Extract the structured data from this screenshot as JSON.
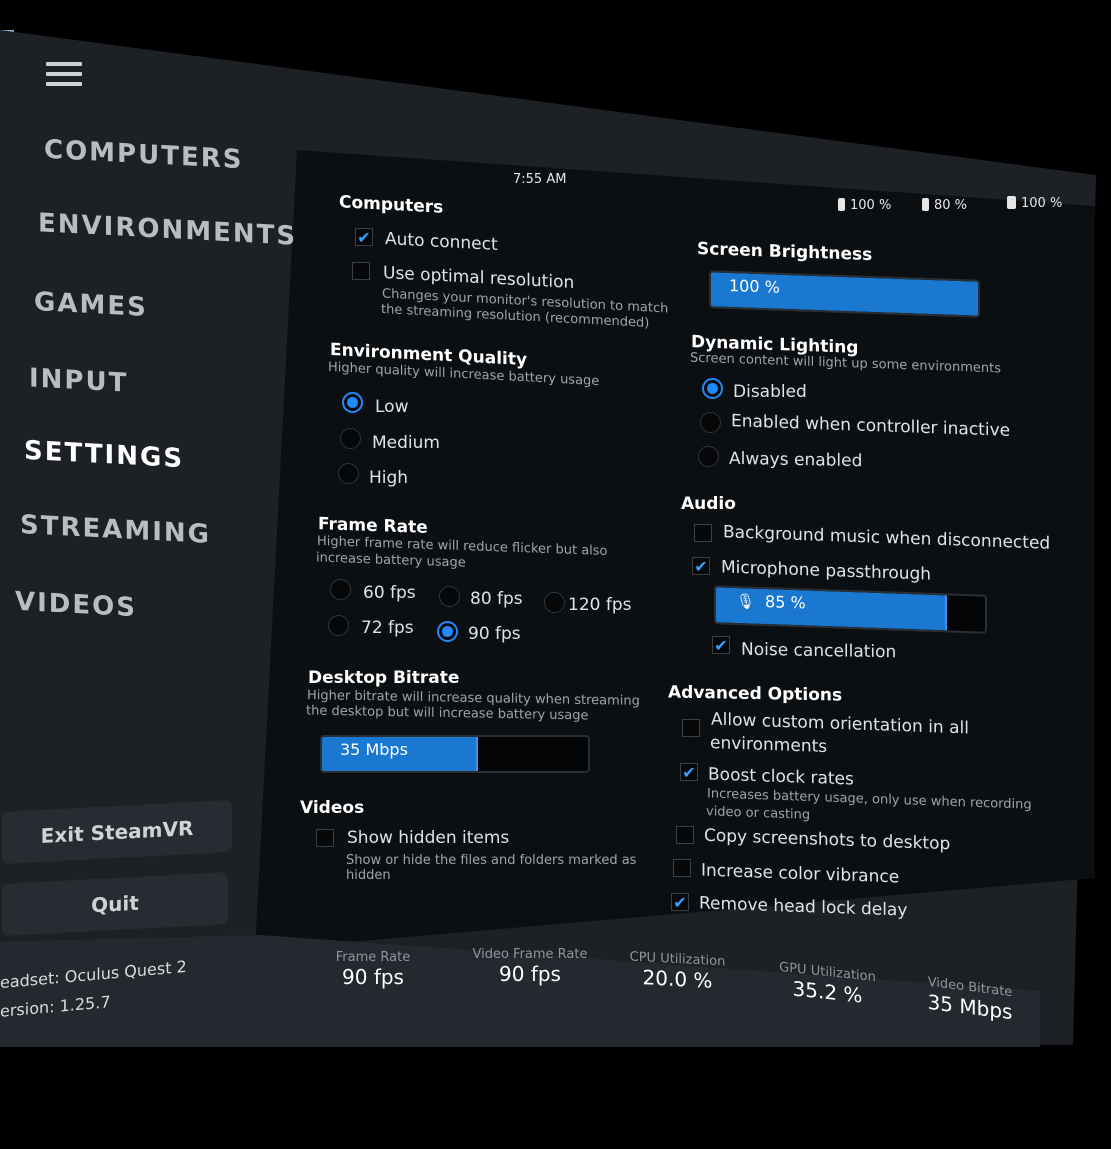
{
  "clock": "7:55 AM",
  "battery": [
    {
      "value": "100 %"
    },
    {
      "value": "80 %"
    },
    {
      "value": "100 %"
    }
  ],
  "nav": [
    "COMPUTERS",
    "ENVIRONMENTS",
    "GAMES",
    "INPUT",
    "SETTINGS",
    "STREAMING",
    "VIDEOS"
  ],
  "buttons": {
    "exit": "Exit SteamVR",
    "quit": "Quit"
  },
  "device": {
    "headset": "eadset:  Oculus Quest 2",
    "version": "ersion:  1.25.7"
  },
  "computers": {
    "title": "Computers",
    "auto_connect": "Auto connect",
    "optimal_res": "Use optimal resolution",
    "optimal_res_desc1": "Changes your monitor's resolution to match",
    "optimal_res_desc2": "the streaming resolution (recommended)"
  },
  "env_quality": {
    "title": "Environment Quality",
    "desc": "Higher quality will increase battery usage",
    "options": [
      "Low",
      "Medium",
      "High"
    ]
  },
  "frame_rate": {
    "title": "Frame Rate",
    "desc1": "Higher frame rate will reduce flicker but also",
    "desc2": "increase battery usage",
    "options": [
      "60 fps",
      "80 fps",
      "120 fps",
      "72 fps",
      "90 fps"
    ]
  },
  "desktop_bitrate": {
    "title": "Desktop Bitrate",
    "desc1": "Higher bitrate will increase quality when streaming",
    "desc2": "the desktop but will increase battery usage",
    "value": "35 Mbps",
    "fraction": 0.58
  },
  "videos": {
    "title": "Videos",
    "show_hidden": "Show hidden items",
    "desc1": "Show or hide the files and folders marked as",
    "desc2": "hidden"
  },
  "brightness": {
    "title": "Screen Brightness",
    "value": "100 %",
    "fraction": 1.0
  },
  "dynamic_lighting": {
    "title": "Dynamic Lighting",
    "desc": "Screen content will light up some environments",
    "options": [
      "Disabled",
      "Enabled when controller inactive",
      "Always enabled"
    ]
  },
  "audio": {
    "title": "Audio",
    "bg_music": "Background music when disconnected",
    "mic": "Microphone passthrough",
    "mic_level": "85 %",
    "mic_fraction": 0.85,
    "noise": "Noise cancellation"
  },
  "advanced": {
    "title": "Advanced Options",
    "custom_orient1": "Allow custom orientation in all",
    "custom_orient2": "environments",
    "boost": "Boost clock rates",
    "boost_desc1": "Increases battery usage, only use when recording",
    "boost_desc2": "video or casting",
    "screenshots": "Copy screenshots to desktop",
    "vibrance": "Increase color vibrance",
    "head_lock": "Remove head lock delay"
  },
  "stats": [
    {
      "label": "Frame Rate",
      "value": "90 fps"
    },
    {
      "label": "Video Frame Rate",
      "value": "90 fps"
    },
    {
      "label": "CPU Utilization",
      "value": "20.0 %"
    },
    {
      "label": "GPU Utilization",
      "value": "35.2 %"
    },
    {
      "label": "Video Bitrate",
      "value": "35 Mbps"
    }
  ],
  "colors": {
    "accent": "#1a78d0",
    "panel": "#1d2125",
    "content": "#0c0f12"
  }
}
